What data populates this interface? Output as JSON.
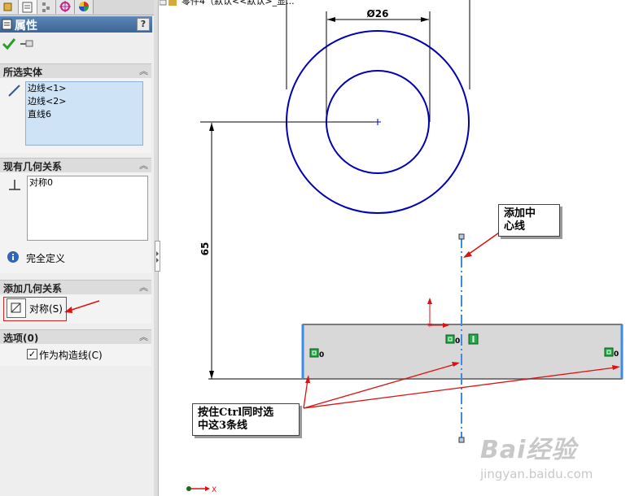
{
  "panel": {
    "title": "属性",
    "help": "?",
    "sections": {
      "selected_entities": {
        "header": "所选实体",
        "items": [
          "边线<1>",
          "边线<2>",
          "直线6"
        ]
      },
      "existing_relations": {
        "header": "现有几何关系",
        "items": [
          "对称0"
        ],
        "status": "完全定义"
      },
      "add_relations": {
        "header": "添加几何关系",
        "button_label": "对称(S)"
      },
      "options": {
        "header": "选项(0)",
        "checkbox_label": "作为构造线(C)",
        "checkbox_checked": true
      }
    }
  },
  "canvas": {
    "tree_text": "零件4（默认<<默认>_显...",
    "dim_diameter": "Ø26",
    "dim_vertical": "65",
    "relation_marker": "0",
    "callout_centerline": [
      "添加中",
      "心线"
    ],
    "callout_select": [
      "按住Ctrl同时选",
      "中这3条线"
    ],
    "axis_x": "X",
    "watermark_brand": "Bai经验",
    "watermark_url": "jingyan.baidu.com"
  },
  "colors": {
    "sketch_blue": "#0000b4",
    "centerline_blue": "#3c8ce6",
    "annotation_red": "#dd1111",
    "dimension_black": "#000000",
    "relation_green": "#22aa44",
    "header_blue": "#4a74a6"
  }
}
